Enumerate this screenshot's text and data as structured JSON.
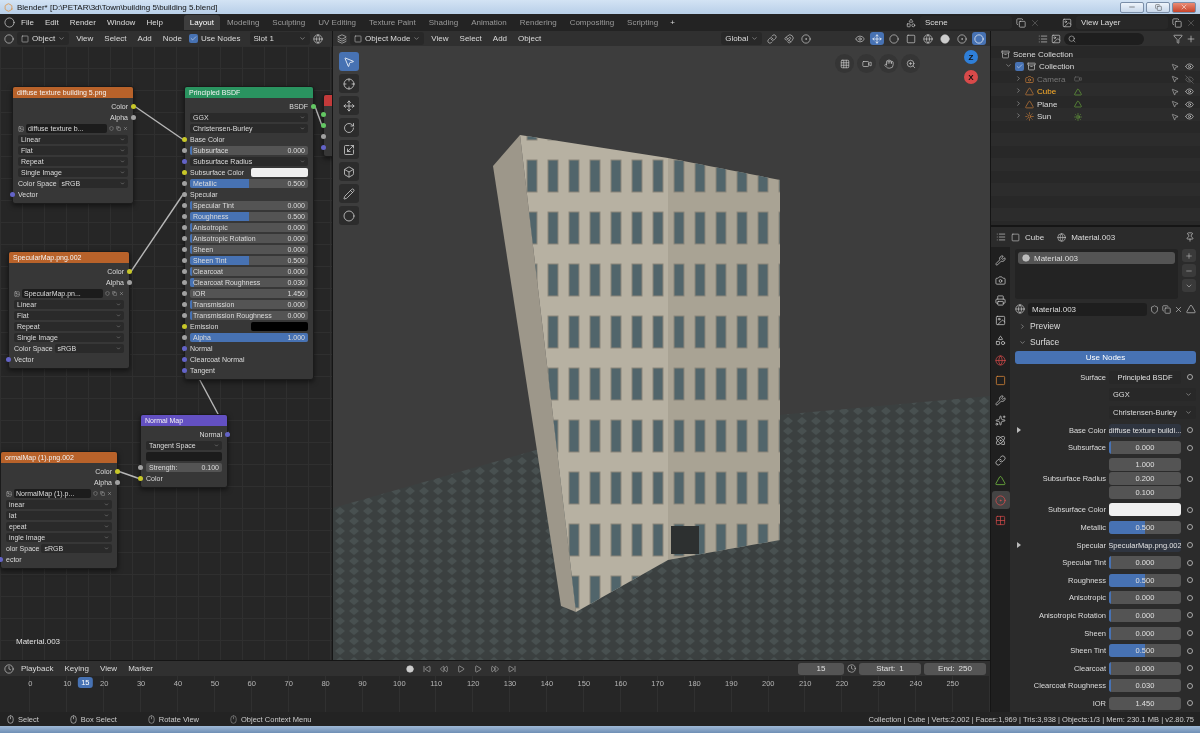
{
  "window": {
    "title": "Blender* [D:\\PETAR\\3d\\Town\\building 5\\building 5.blend]"
  },
  "menu": [
    "File",
    "Edit",
    "Render",
    "Window",
    "Help"
  ],
  "workspaces": [
    {
      "label": "Layout",
      "selected": true
    },
    {
      "label": "Modeling",
      "selected": false
    },
    {
      "label": "Sculpting",
      "selected": false
    },
    {
      "label": "UV Editing",
      "selected": false
    },
    {
      "label": "Texture Paint",
      "selected": false
    },
    {
      "label": "Shading",
      "selected": false
    },
    {
      "label": "Animation",
      "selected": false
    },
    {
      "label": "Rendering",
      "selected": false
    },
    {
      "label": "Compositing",
      "selected": false
    },
    {
      "label": "Scripting",
      "selected": false
    }
  ],
  "add_workspace": "+",
  "scene": "Scene",
  "view_layer": "View Layer",
  "node_editor": {
    "object_type": "Object",
    "menus": [
      "View",
      "Select",
      "Add",
      "Node"
    ],
    "use_nodes": {
      "label": "Use Nodes",
      "checked": true
    },
    "slot": "Slot 1",
    "material": "Material.003",
    "nodes": [
      {
        "kind": "image",
        "title": "diffuse texture building 5.png",
        "rows": [
          {
            "kind": "output",
            "label": "Color",
            "socket": {
              "kind": "color"
            }
          },
          {
            "kind": "output",
            "label": "Alpha",
            "socket": {
              "kind": "float"
            }
          },
          {
            "kind": "file",
            "value": "diffuse texture b..."
          },
          {
            "kind": "dropdown",
            "value": "Linear"
          },
          {
            "kind": "dropdown",
            "value": "Flat"
          },
          {
            "kind": "dropdown",
            "value": "Repeat"
          },
          {
            "kind": "dropdown",
            "value": "Single Image"
          },
          {
            "kind": "property",
            "label": "Color Space",
            "value": "sRGB"
          },
          {
            "kind": "input",
            "label": "Vector",
            "socket": {
              "kind": "vector"
            }
          }
        ]
      },
      {
        "kind": "shader",
        "title": "Principled BSDF",
        "rows": [
          {
            "kind": "output",
            "label": "BSDF",
            "socket": {
              "kind": "shader"
            }
          },
          {
            "kind": "dropdown",
            "value": "GGX"
          },
          {
            "kind": "dropdown",
            "value": "Christensen-Burley"
          },
          {
            "kind": "input",
            "label": "Base Color",
            "socket": {
              "kind": "color"
            }
          },
          {
            "kind": "slider",
            "label": "Subsurface",
            "value": "0.000",
            "level": 0,
            "socket": {
              "kind": "float"
            }
          },
          {
            "kind": "dropdown",
            "value": "Subsurface Radius",
            "socket": {
              "kind": "vector"
            }
          },
          {
            "kind": "color",
            "label": "Subsurface Color",
            "color": "#f0f0f0",
            "socket": {
              "kind": "color"
            }
          },
          {
            "kind": "slider",
            "label": "Metallic",
            "value": "0.500",
            "level": 0.5,
            "socket": {
              "kind": "float"
            }
          },
          {
            "kind": "input",
            "label": "Specular",
            "socket": {
              "kind": "float"
            }
          },
          {
            "kind": "slider",
            "label": "Specular Tint",
            "value": "0.000",
            "level": 0,
            "socket": {
              "kind": "float"
            }
          },
          {
            "kind": "slider",
            "label": "Roughness",
            "value": "0.500",
            "level": 0.5,
            "socket": {
              "kind": "float"
            }
          },
          {
            "kind": "slider",
            "label": "Anisotropic",
            "value": "0.000",
            "level": 0,
            "socket": {
              "kind": "float"
            }
          },
          {
            "kind": "slider",
            "label": "Anisotropic Rotation",
            "value": "0.000",
            "level": 0,
            "socket": {
              "kind": "float"
            }
          },
          {
            "kind": "slider",
            "label": "Sheen",
            "value": "0.000",
            "level": 0,
            "socket": {
              "kind": "float"
            }
          },
          {
            "kind": "slider",
            "label": "Sheen Tint",
            "value": "0.500",
            "level": 0.5,
            "socket": {
              "kind": "float"
            }
          },
          {
            "kind": "slider",
            "label": "Clearcoat",
            "value": "0.000",
            "level": 0,
            "socket": {
              "kind": "float"
            }
          },
          {
            "kind": "slider",
            "label": "Clearcoat Roughness",
            "value": "0.030",
            "level": 0.03,
            "socket": {
              "kind": "float"
            }
          },
          {
            "kind": "number",
            "label": "IOR",
            "value": "1.450",
            "socket": {
              "kind": "float"
            }
          },
          {
            "kind": "slider",
            "label": "Transmission",
            "value": "0.000",
            "level": 0,
            "socket": {
              "kind": "float"
            }
          },
          {
            "kind": "slider",
            "label": "Transmission Roughness",
            "value": "0.000",
            "level": 0,
            "socket": {
              "kind": "float"
            }
          },
          {
            "kind": "color",
            "label": "Emission",
            "color": "#000000",
            "socket": {
              "kind": "color"
            }
          },
          {
            "kind": "slider",
            "label": "Alpha",
            "value": "1.000",
            "level": 1,
            "socket": {
              "kind": "float"
            }
          },
          {
            "kind": "input",
            "label": "Normal",
            "socket": {
              "kind": "vector"
            }
          },
          {
            "kind": "input",
            "label": "Clearcoat Normal",
            "socket": {
              "kind": "vector"
            }
          },
          {
            "kind": "input",
            "label": "Tangent",
            "socket": {
              "kind": "vector"
            }
          }
        ]
      },
      {
        "kind": "image",
        "title": "SpecularMap.png.002",
        "rows": [
          {
            "kind": "output",
            "label": "Color",
            "socket": {
              "kind": "color"
            }
          },
          {
            "kind": "output",
            "label": "Alpha",
            "socket": {
              "kind": "float"
            }
          },
          {
            "kind": "file",
            "value": "SpecularMap.pn..."
          },
          {
            "kind": "dropdown",
            "value": "Linear"
          },
          {
            "kind": "dropdown",
            "value": "Flat"
          },
          {
            "kind": "dropdown",
            "value": "Repeat"
          },
          {
            "kind": "dropdown",
            "value": "Single Image"
          },
          {
            "kind": "property",
            "label": "Color Space",
            "value": "sRGB"
          },
          {
            "kind": "input",
            "label": "Vector",
            "socket": {
              "kind": "vector"
            }
          }
        ]
      },
      {
        "kind": "vector",
        "title": "Normal Map",
        "rows": [
          {
            "kind": "output",
            "label": "Normal",
            "socket": {
              "kind": "vector"
            }
          },
          {
            "kind": "dropdown",
            "value": "Tangent Space"
          },
          {
            "kind": "field"
          },
          {
            "kind": "number",
            "label": "Strength:",
            "value": "0.100",
            "socket": {
              "kind": "float"
            }
          },
          {
            "kind": "input",
            "label": "Color",
            "socket": {
              "kind": "color"
            }
          }
        ]
      },
      {
        "kind": "image",
        "title": "ormalMap (1).png.002",
        "rows": [
          {
            "kind": "output",
            "label": "Color",
            "socket": {
              "kind": "color"
            }
          },
          {
            "kind": "output",
            "label": "Alpha",
            "socket": {
              "kind": "float"
            }
          },
          {
            "kind": "file",
            "value": "NormalMap (1).p..."
          },
          {
            "kind": "dropdown",
            "value": "inear"
          },
          {
            "kind": "dropdown",
            "value": "lat"
          },
          {
            "kind": "dropdown",
            "value": "epeat"
          },
          {
            "kind": "dropdown",
            "value": "ingle Image"
          },
          {
            "kind": "property",
            "label": "olor Space",
            "value": "sRGB"
          },
          {
            "kind": "input",
            "label": "ector",
            "socket": {
              "kind": "vector"
            }
          }
        ]
      },
      {
        "kind": "output",
        "rows": [
          {
            "kind": "input",
            "socket": {
              "kind": "shader"
            }
          },
          {
            "kind": "input",
            "socket": {
              "kind": "shader"
            }
          },
          {
            "kind": "input",
            "socket": {
              "kind": "float"
            }
          },
          {
            "kind": "input",
            "socket": {
              "kind": "vector"
            }
          }
        ]
      }
    ]
  },
  "viewport": {
    "mode": "Object Mode",
    "menus": [
      "View",
      "Select",
      "Add",
      "Object"
    ],
    "orientation": "Global",
    "tools": [
      {
        "kind": "select",
        "selected": true
      },
      {
        "kind": "cursor",
        "selected": false
      },
      {
        "kind": "move",
        "selected": false
      },
      {
        "kind": "rotate",
        "selected": false
      },
      {
        "kind": "scale",
        "selected": false
      },
      {
        "kind": "transform",
        "selected": false
      },
      {
        "kind": "annotate",
        "selected": false
      },
      {
        "kind": "measure",
        "selected": false
      }
    ],
    "axes": [
      {
        "label": "Z",
        "color": "#2f7fd8"
      },
      {
        "label": "X",
        "color": "#d84a4a"
      }
    ]
  },
  "timeline": {
    "menus": [
      "Playback",
      "Keying",
      "View",
      "Marker"
    ],
    "frame": "15",
    "start": {
      "label": "Start:",
      "value": "1"
    },
    "end": {
      "label": "End:",
      "value": "250"
    },
    "ruler": [
      "0",
      "10",
      "20",
      "30",
      "40",
      "50",
      "60",
      "70",
      "80",
      "90",
      "100",
      "110",
      "120",
      "130",
      "140",
      "150",
      "160",
      "170",
      "180",
      "190",
      "200",
      "210",
      "220",
      "230",
      "240",
      "250"
    ],
    "playhead": {
      "label": "15",
      "level": 0.06
    }
  },
  "outliner": {
    "root": "Scene Collection",
    "tree": [
      {
        "label": "Collection",
        "kind": "collection",
        "expanded": true,
        "checked": true,
        "visible": true,
        "selected": false,
        "children": [
          {
            "label": "Camera",
            "kind": "camera",
            "expanded": false,
            "visible": false,
            "selected": false
          },
          {
            "label": "Cube",
            "kind": "mesh",
            "expanded": false,
            "visible": true,
            "selected": true
          },
          {
            "label": "Plane",
            "kind": "mesh",
            "expanded": false,
            "visible": true,
            "selected": false
          },
          {
            "label": "Sun",
            "kind": "light",
            "expanded": false,
            "visible": true,
            "selected": false
          }
        ]
      }
    ]
  },
  "properties": {
    "object": "Cube",
    "material": "Material.003",
    "tabs": [
      {
        "kind": "tool",
        "selected": false
      },
      {
        "kind": "render",
        "selected": false
      },
      {
        "kind": "output",
        "selected": false
      },
      {
        "kind": "view_layer",
        "selected": false
      },
      {
        "kind": "scene",
        "selected": false
      },
      {
        "kind": "world",
        "selected": false
      },
      {
        "kind": "object",
        "selected": false
      },
      {
        "kind": "modifier",
        "selected": false
      },
      {
        "kind": "particles",
        "selected": false
      },
      {
        "kind": "physics",
        "selected": false
      },
      {
        "kind": "constraint",
        "selected": false
      },
      {
        "kind": "data",
        "selected": false
      },
      {
        "kind": "material",
        "selected": true
      },
      {
        "kind": "texture",
        "selected": false
      }
    ],
    "slots": [
      {
        "label": "Material.003",
        "selected": true
      }
    ],
    "material_name": "Material.003",
    "panels": [
      {
        "label": "Preview",
        "expanded": false
      },
      {
        "label": "Surface",
        "expanded": true
      }
    ],
    "use_nodes": "Use Nodes",
    "rows": [
      {
        "kind": "link",
        "label": "Surface",
        "value": "Principled BSDF",
        "expandable": false
      },
      {
        "kind": "dropdown",
        "value": "GGX"
      },
      {
        "kind": "dropdown",
        "value": "Christensen-Burley"
      },
      {
        "kind": "link",
        "label": "Base Color",
        "value": "diffuse texture buildi...",
        "expandable": true
      },
      {
        "kind": "slider",
        "label": "Subsurface",
        "value": "0.000",
        "level": 0
      },
      {
        "kind": "vector",
        "label": "Subsurface Radius",
        "values": [
          "1.000",
          "0.200",
          "0.100"
        ]
      },
      {
        "kind": "color",
        "label": "Subsurface Color",
        "color": "#f0f0f0"
      },
      {
        "kind": "slider",
        "label": "Metallic",
        "value": "0.500",
        "level": 0.5
      },
      {
        "kind": "link",
        "label": "Specular",
        "value": "SpecularMap.png.002",
        "expandable": true
      },
      {
        "kind": "slider",
        "label": "Specular Tint",
        "value": "0.000",
        "level": 0
      },
      {
        "kind": "slider",
        "label": "Roughness",
        "value": "0.500",
        "level": 0.5
      },
      {
        "kind": "slider",
        "label": "Anisotropic",
        "value": "0.000",
        "level": 0
      },
      {
        "kind": "slider",
        "label": "Anisotropic Rotation",
        "value": "0.000",
        "level": 0
      },
      {
        "kind": "slider",
        "label": "Sheen",
        "value": "0.000",
        "level": 0
      },
      {
        "kind": "slider",
        "label": "Sheen Tint",
        "value": "0.500",
        "level": 0.5
      },
      {
        "kind": "slider",
        "label": "Clearcoat",
        "value": "0.000",
        "level": 0
      },
      {
        "kind": "slider",
        "label": "Clearcoat Roughness",
        "value": "0.030",
        "level": 0.03
      },
      {
        "kind": "number",
        "label": "IOR",
        "value": "1.450"
      }
    ]
  },
  "status": {
    "hints": [
      {
        "kind": "left",
        "label": "Select"
      },
      {
        "kind": "left",
        "label": "Box Select"
      },
      {
        "kind": "middle",
        "label": "Rotate View"
      },
      {
        "kind": "right",
        "label": "Object Context Menu"
      }
    ],
    "stats": "Collection | Cube | Verts:2,002 | Faces:1,969 | Tris:3,938 | Objects:1/3 | Mem: 230.1 MB | v2.80.75"
  }
}
